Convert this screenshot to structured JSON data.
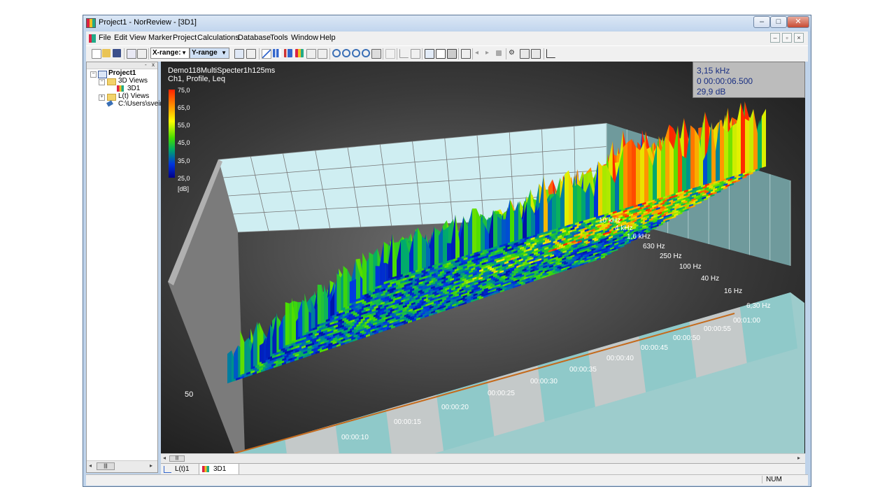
{
  "window": {
    "title": "Project1 - NorReview - [3D1]"
  },
  "caption_buttons": {
    "minimize": "–",
    "maximize": "□",
    "close": "✕"
  },
  "mdi_buttons": {
    "minimize": "–",
    "restore": "▫",
    "close": "×"
  },
  "menu": {
    "items": [
      "File",
      "Edit",
      "View",
      "Marker",
      "Project",
      "Calculations",
      "Database",
      "Tools",
      "Window",
      "Help"
    ]
  },
  "toolbar": {
    "xrange": "X-range:",
    "yrange": "Y-range"
  },
  "tree": {
    "pane_buttons": {
      "pin": "-",
      "close": "x"
    },
    "root": "Project1",
    "folder_3d": "3D Views",
    "item_3d1": "3D1",
    "folder_lt": "L(t) Views",
    "path": "C:\\Users\\svein\\"
  },
  "plot": {
    "title": "Demo118MultiSpecter1h125ms",
    "subtitle": "Ch1, Profile, Leq",
    "colorbar_ticks": [
      "75,0",
      "65,0",
      "55,0",
      "45,0",
      "35,0",
      "25,0"
    ],
    "colorbar_unit": "[dB]",
    "colors": {
      "background": "#2a2a2a",
      "floor_teal": "#8ec9c9",
      "floor_grey": "#c9c9c9",
      "back_wall": "#cfeef2"
    },
    "time_labels": [
      "00:00:10",
      "00:00:15",
      "00:00:20",
      "00:00:25",
      "00:00:30",
      "00:00:35",
      "00:00:40",
      "00:00:45",
      "00:00:50",
      "00:00:55",
      "00:01:00"
    ],
    "freq_labels": [
      "10 kHz",
      "4 kHz",
      "1,6 kHz",
      "630 Hz",
      "250 Hz",
      "100 Hz",
      "40 Hz",
      "16 Hz",
      "6,30 Hz"
    ],
    "left_value": "50"
  },
  "cursor": {
    "frequency": "3,15 kHz",
    "time": "0 00:00:06.500",
    "level": "29,9 dB"
  },
  "tabs": [
    {
      "label": "L(t)1",
      "icon": "lt-chart-icon"
    },
    {
      "label": "3D1",
      "icon": "3d-chart-icon"
    }
  ],
  "status": {
    "num": "NUM"
  }
}
